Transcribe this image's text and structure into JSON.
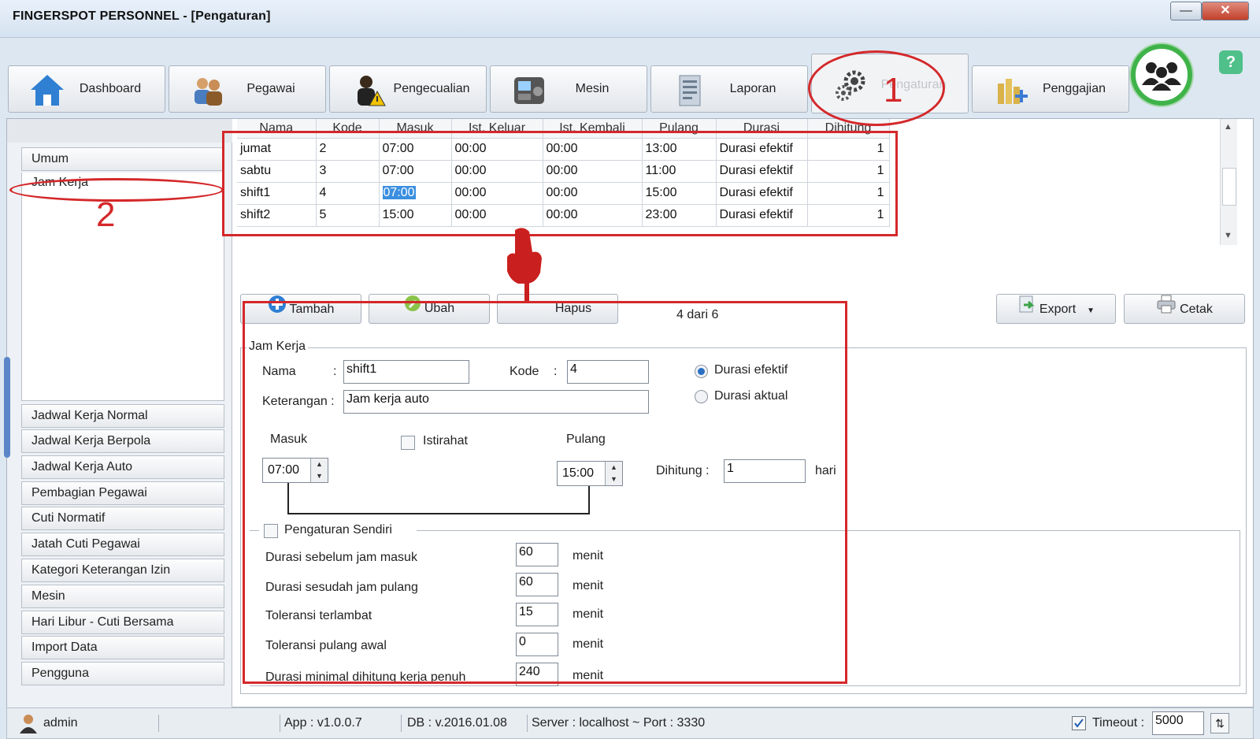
{
  "window": {
    "title": "FINGERSPOT PERSONNEL - [Pengaturan]"
  },
  "tabs": [
    {
      "label": "Dashboard",
      "icon": "home-icon"
    },
    {
      "label": "Pegawai",
      "icon": "people-icon"
    },
    {
      "label": "Pengecualian",
      "icon": "warning-person-icon"
    },
    {
      "label": "Mesin",
      "icon": "fingerprint-machine-icon"
    },
    {
      "label": "Laporan",
      "icon": "report-icon"
    },
    {
      "label": "Pengaturan",
      "icon": "gears-icon"
    },
    {
      "label": "Penggajian",
      "icon": "coins-icon"
    }
  ],
  "active_tab": "Pengaturan",
  "sidebar": {
    "top_items": [
      "Umum",
      "Jam Kerja"
    ],
    "bottom_items": [
      "Jadwal Kerja Normal",
      "Jadwal Kerja Berpola",
      "Jadwal Kerja Auto",
      "Pembagian Pegawai",
      "Cuti Normatif",
      "Jatah Cuti Pegawai",
      "Kategori Keterangan Izin",
      "Mesin",
      "Hari Libur - Cuti Bersama",
      "Import Data",
      "Pengguna"
    ]
  },
  "grid": {
    "columns": [
      "Nama",
      "Kode",
      "Masuk",
      "Ist. Keluar",
      "Ist. Kembali",
      "Pulang",
      "Durasi",
      "Dihitung"
    ],
    "rows": [
      [
        "jumat",
        "2",
        "07:00",
        "00:00",
        "00:00",
        "13:00",
        "Durasi efektif",
        "1"
      ],
      [
        "sabtu",
        "3",
        "07:00",
        "00:00",
        "00:00",
        "11:00",
        "Durasi efektif",
        "1"
      ],
      [
        "shift1",
        "4",
        "07:00",
        "00:00",
        "00:00",
        "15:00",
        "Durasi efektif",
        "1"
      ],
      [
        "shift2",
        "5",
        "15:00",
        "00:00",
        "00:00",
        "23:00",
        "Durasi efektif",
        "1"
      ]
    ]
  },
  "toolbar": {
    "tambah": "Tambah",
    "ubah": "Ubah",
    "hapus": "Hapus",
    "record_count": "4 dari 6",
    "export": "Export",
    "cetak": "Cetak"
  },
  "form": {
    "group_title": "Jam Kerja",
    "nama_label": "Nama",
    "colon": ":",
    "nama_value": "shift1",
    "kode_label": "Kode",
    "kode_value": "4",
    "keterangan_label": "Keterangan :",
    "keterangan_value": "Jam kerja auto",
    "radio_efektif": "Durasi efektif",
    "radio_aktual": "Durasi aktual",
    "radio_selected": "Durasi efektif",
    "masuk_label": "Masuk",
    "masuk_value": "07:00",
    "istirahat_label": "Istirahat",
    "istirahat_checked": false,
    "pulang_label": "Pulang",
    "pulang_value": "15:00",
    "dihitung_label": "Dihitung :",
    "dihitung_value": "1",
    "hari": "hari",
    "pengaturan_sendiri_label": "Pengaturan Sendiri",
    "pengaturan_sendiri_checked": false,
    "settings": [
      {
        "label": "Durasi sebelum jam masuk",
        "value": "60",
        "unit": "menit"
      },
      {
        "label": "Durasi sesudah jam pulang",
        "value": "60",
        "unit": "menit"
      },
      {
        "label": "Toleransi terlambat",
        "value": "15",
        "unit": "menit"
      },
      {
        "label": "Toleransi pulang awal",
        "value": "0",
        "unit": "menit"
      },
      {
        "label": "Durasi minimal dihitung kerja penuh",
        "value": "240",
        "unit": "menit"
      }
    ]
  },
  "status": {
    "user": "admin",
    "app": "App : v1.0.0.7",
    "db": "DB : v.2016.01.08",
    "server": "Server : localhost ~ Port : 3330",
    "timeout_label": "Timeout :",
    "timeout_value": "5000",
    "timeout_checked": true
  },
  "annotations": {
    "one": "1",
    "two": "2"
  },
  "colors": {
    "annotation": "#d4282a",
    "accent": "#2a6fc2",
    "selection": "#3b8fe0",
    "users_ring": "#3fb34a"
  }
}
